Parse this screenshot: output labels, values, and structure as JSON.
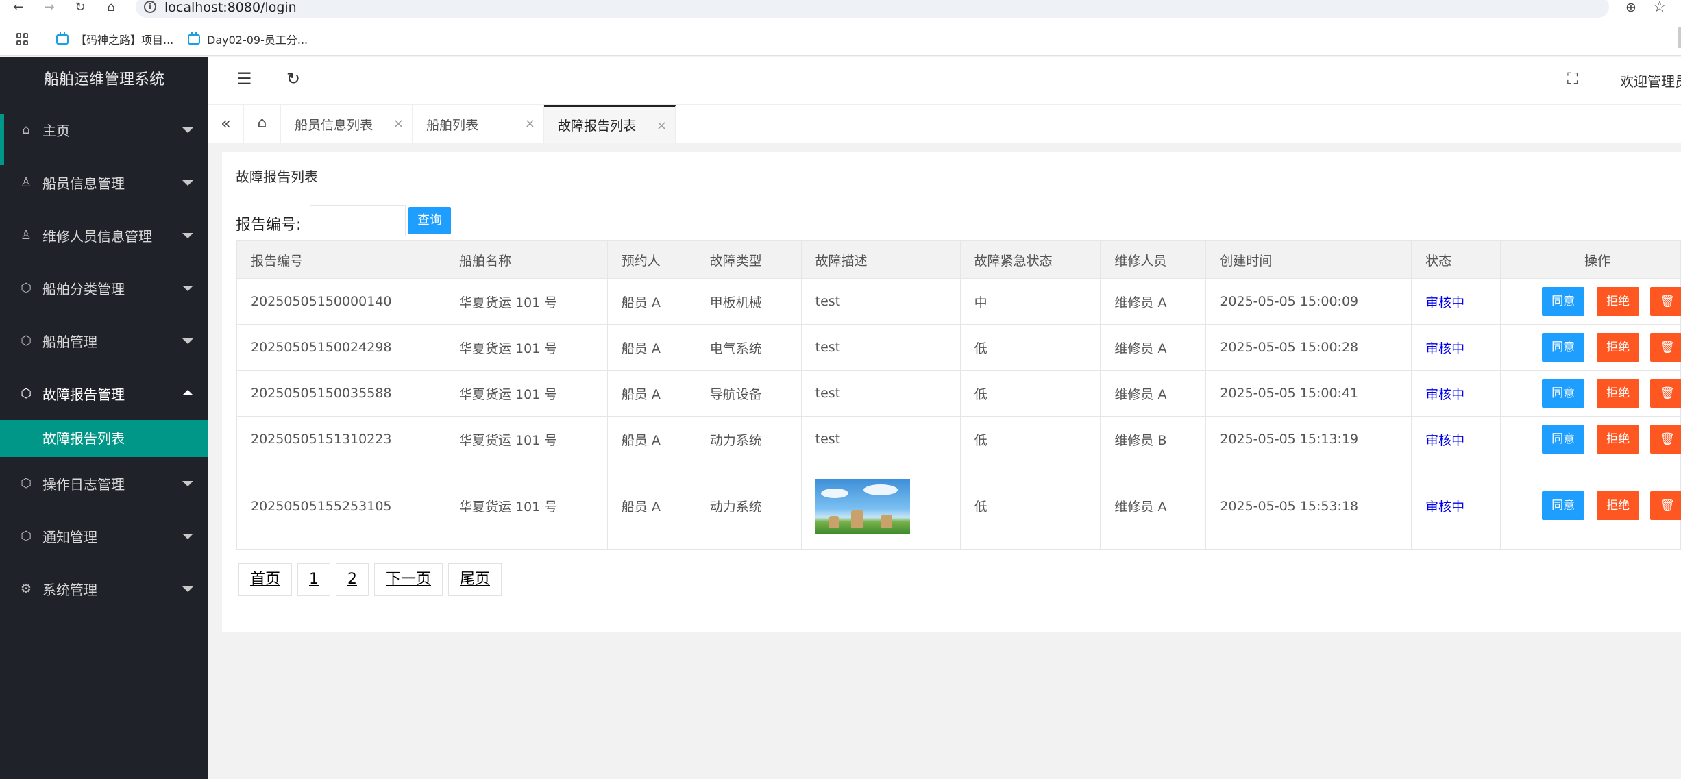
{
  "browser": {
    "url": "localhost:8080/login",
    "bookmarks": [
      "【码神之路】项目...",
      "Day02-09-员工分..."
    ]
  },
  "sidebar": {
    "title": "船舶运维管理系统",
    "items": [
      {
        "label": "主页",
        "icon": "home-icon"
      },
      {
        "label": "船员信息管理",
        "icon": "user-icon"
      },
      {
        "label": "维修人员信息管理",
        "icon": "user-icon"
      },
      {
        "label": "船舶分类管理",
        "icon": "cube-icon"
      },
      {
        "label": "船舶管理",
        "icon": "cube-icon"
      },
      {
        "label": "故障报告管理",
        "icon": "cube-icon"
      },
      {
        "label": "操作日志管理",
        "icon": "cube-icon"
      },
      {
        "label": "通知管理",
        "icon": "cube-icon"
      },
      {
        "label": "系统管理",
        "icon": "gear-icon"
      }
    ],
    "active_sub": "故障报告列表"
  },
  "header": {
    "welcome": "欢迎管理员"
  },
  "tabs": [
    {
      "label": "船员信息列表"
    },
    {
      "label": "船舶列表"
    },
    {
      "label": "故障报告列表"
    }
  ],
  "card": {
    "title": "故障报告列表",
    "search_label": "报告编号:",
    "search_value": "",
    "search_button": "查询"
  },
  "table": {
    "headers": [
      "报告编号",
      "船舶名称",
      "预约人",
      "故障类型",
      "故障描述",
      "故障紧急状态",
      "维修人员",
      "创建时间",
      "状态",
      "操作"
    ],
    "rows": [
      {
        "id": "20250505150000140",
        "ship": "华夏货运 101 号",
        "booker": "船员 A",
        "type": "甲板机械",
        "desc": "test",
        "urgency": "中",
        "repairer": "维修员 A",
        "created": "2025-05-05 15:00:09",
        "status": "审核中"
      },
      {
        "id": "20250505150024298",
        "ship": "华夏货运 101 号",
        "booker": "船员 A",
        "type": "电气系统",
        "desc": "test",
        "urgency": "低",
        "repairer": "维修员 A",
        "created": "2025-05-05 15:00:28",
        "status": "审核中"
      },
      {
        "id": "20250505150035588",
        "ship": "华夏货运 101 号",
        "booker": "船员 A",
        "type": "导航设备",
        "desc": "test",
        "urgency": "低",
        "repairer": "维修员 A",
        "created": "2025-05-05 15:00:41",
        "status": "审核中"
      },
      {
        "id": "20250505151310223",
        "ship": "华夏货运 101 号",
        "booker": "船员 A",
        "type": "动力系统",
        "desc": "test",
        "urgency": "低",
        "repairer": "维修员 B",
        "created": "2025-05-05 15:13:19",
        "status": "审核中"
      },
      {
        "id": "20250505155253105",
        "ship": "华夏货运 101 号",
        "booker": "船员 A",
        "type": "动力系统",
        "desc": "",
        "urgency": "低",
        "repairer": "维修员 A",
        "created": "2025-05-05 15:53:18",
        "status": "审核中"
      }
    ],
    "buttons": {
      "agree": "同意",
      "reject": "拒绝",
      "delete": "🗑"
    }
  },
  "pager": [
    "首页",
    "1",
    "2",
    "下一页",
    "尾页"
  ]
}
